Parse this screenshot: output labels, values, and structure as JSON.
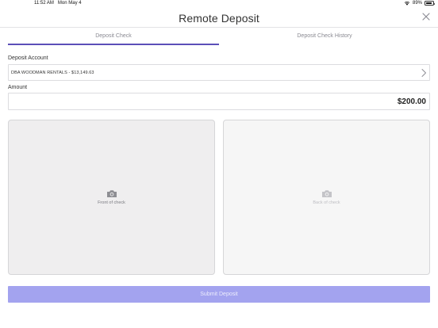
{
  "status_bar": {
    "time": "11:52 AM",
    "date": "Mon May 4",
    "battery": "89%",
    "battery_level": 0.89,
    "icons": [
      "wifi-icon",
      "battery-icon"
    ]
  },
  "header": {
    "title": "Remote Deposit",
    "close_icon": "close-icon"
  },
  "tabs": [
    {
      "label": "Deposit Check",
      "active": true
    },
    {
      "label": "Deposit Check History",
      "active": false
    }
  ],
  "form": {
    "account_label": "Deposit Account",
    "account_value": "DBA WOODMAN RENTALS - $13,149.63",
    "amount_label": "Amount",
    "amount_value": "$200.00"
  },
  "checks": {
    "front_label": "Front of check",
    "back_label": "Back of check",
    "icon": "camera-icon"
  },
  "submit_label": "Submit Deposit",
  "colors": {
    "accent": "#5b4fb8",
    "submit_bg": "#a3a3ef",
    "card_front_bg": "#efeeef",
    "card_back_bg": "#f6f6f6"
  }
}
